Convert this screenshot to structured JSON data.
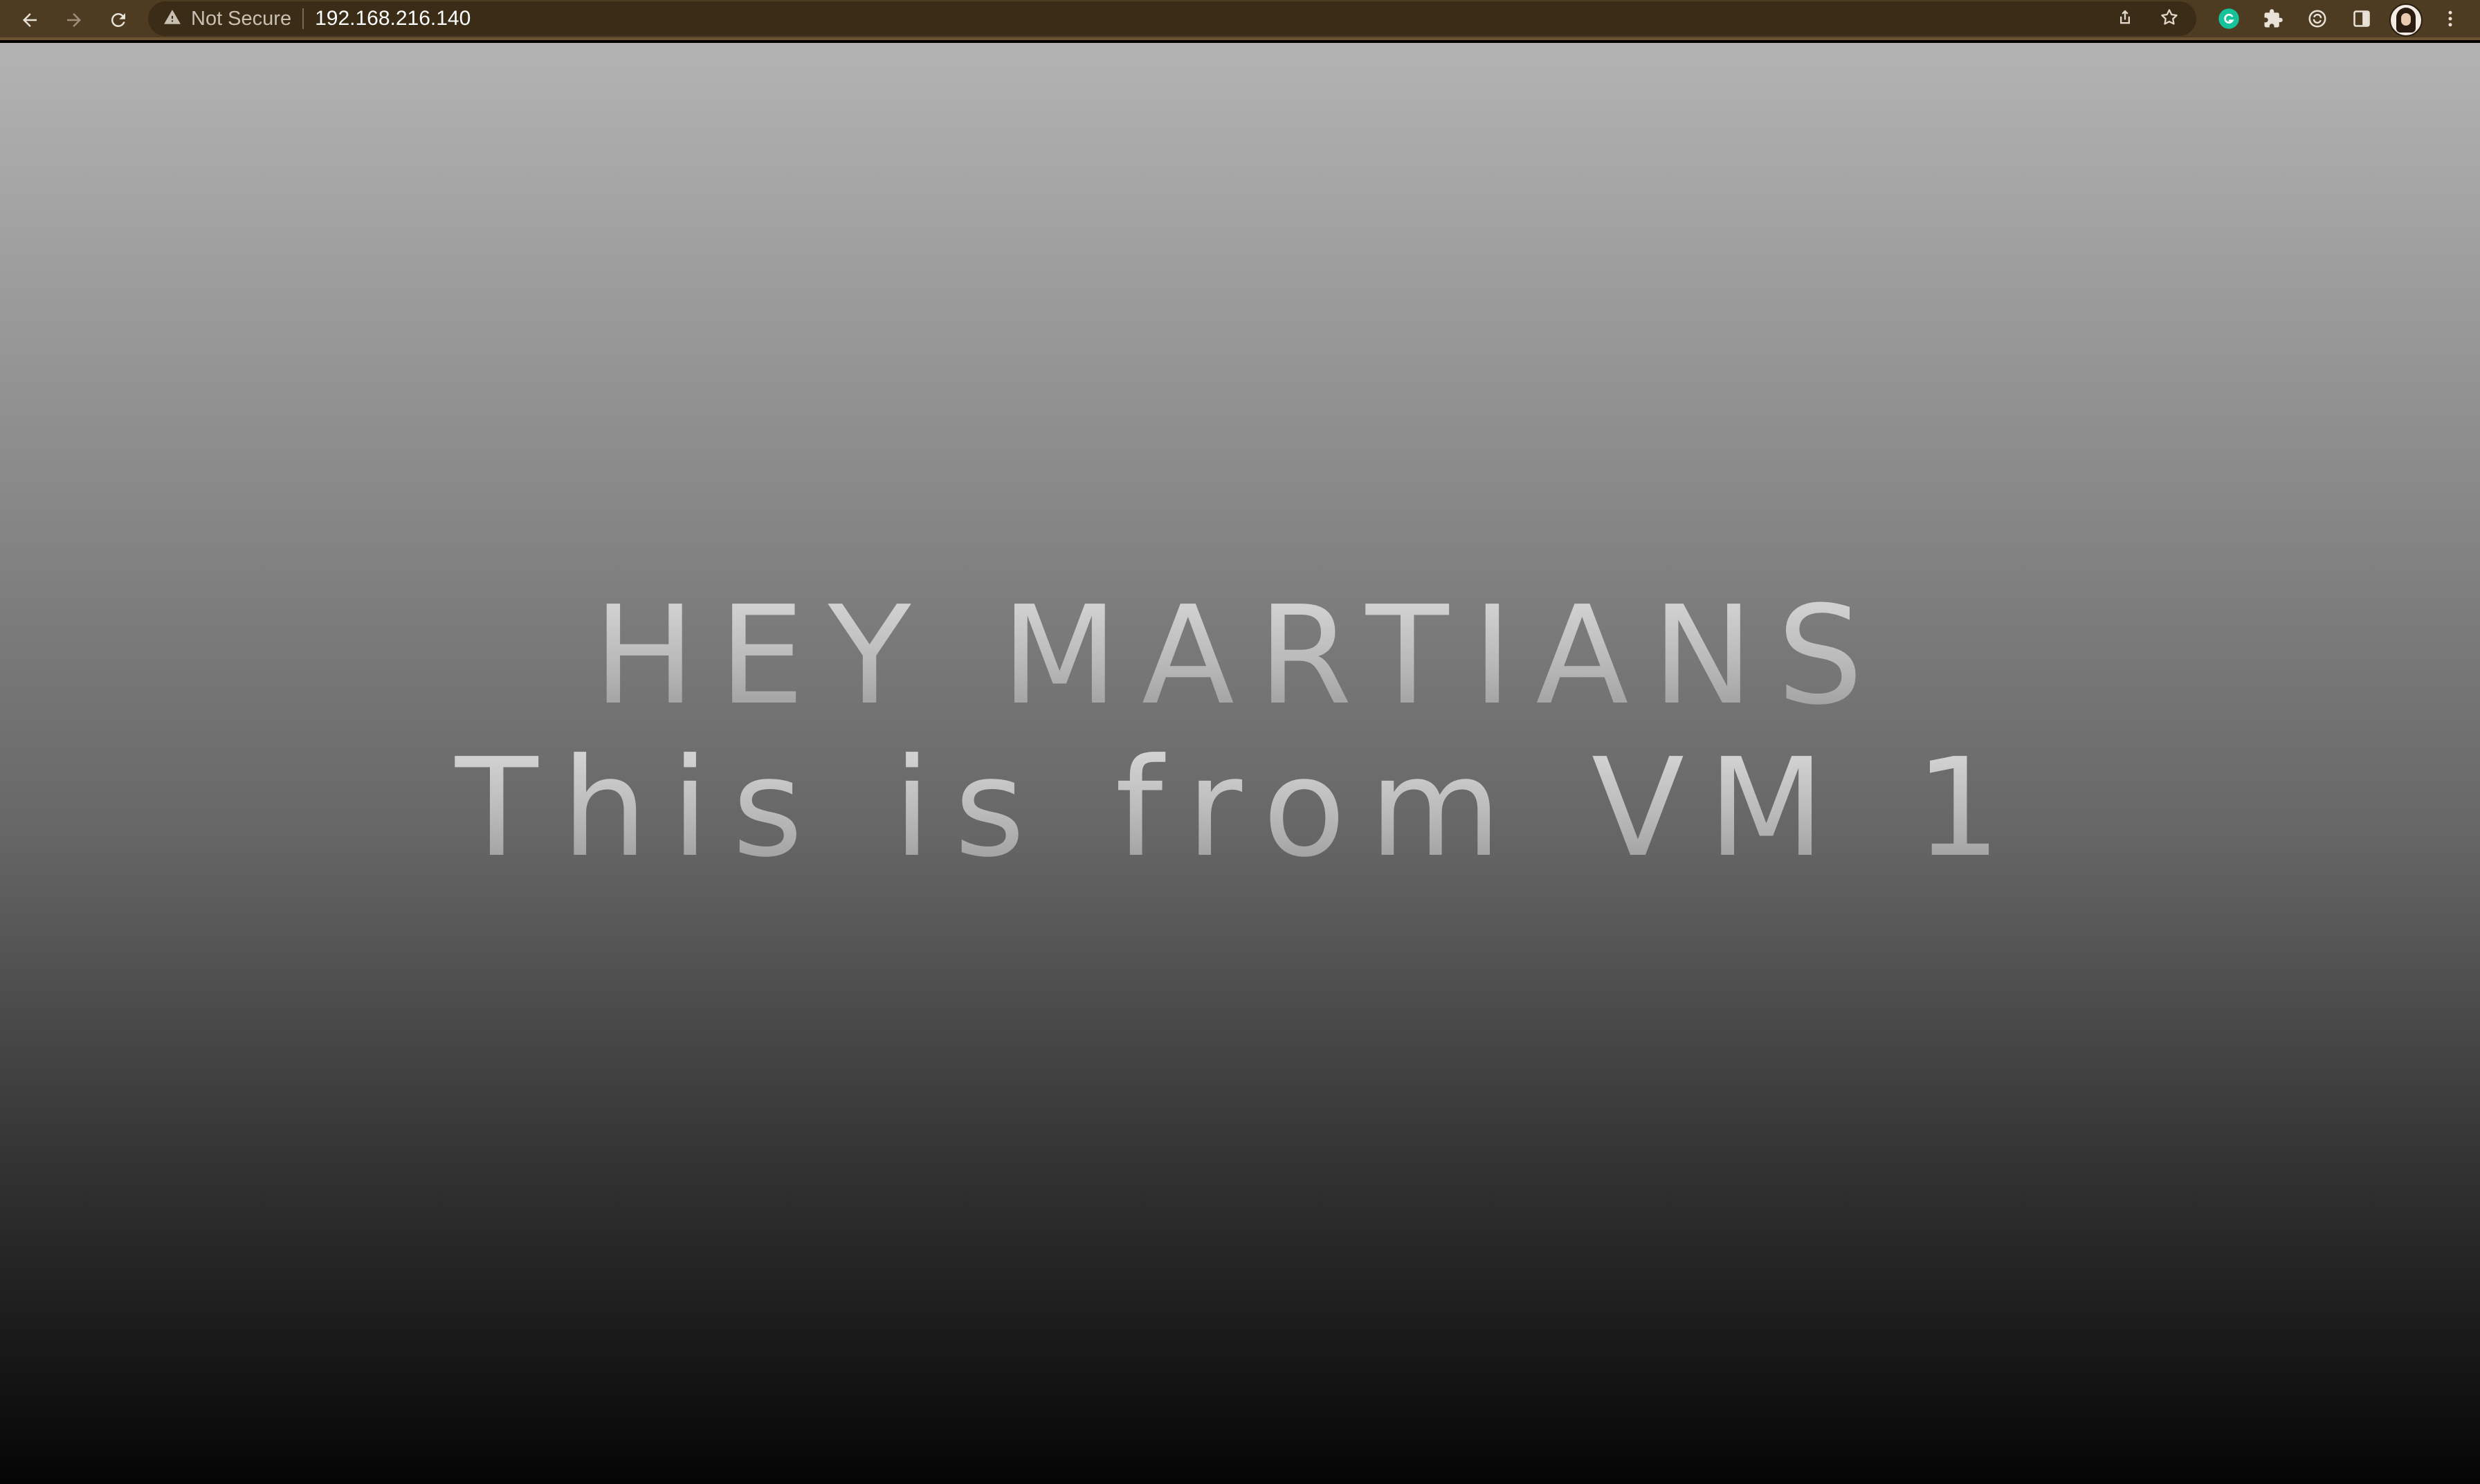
{
  "browser": {
    "nav": {
      "back_icon": "arrow-left-icon",
      "forward_icon": "arrow-right-icon",
      "reload_icon": "reload-icon"
    },
    "omnibox": {
      "security_icon": "warning-triangle-icon",
      "security_label": "Not Secure",
      "url": "192.168.216.140",
      "share_icon": "share-icon",
      "bookmark_icon": "star-icon"
    },
    "toolbar_icons": [
      "grammarly-icon",
      "extensions-puzzle-icon",
      "sync-icon",
      "side-panel-icon",
      "profile-avatar",
      "more-vert-icon"
    ],
    "colors": {
      "toolbar_bg": "#4e3c22",
      "omnibox_bg": "#3a2c16",
      "grammarly_green": "#15c39a"
    }
  },
  "page": {
    "line1": "HEY MARTIANS",
    "line2": "This is from VM 1",
    "colors": {
      "gradient_top": "#b3b3b3",
      "gradient_bottom": "#050505",
      "text": "#c4c4c4"
    }
  }
}
